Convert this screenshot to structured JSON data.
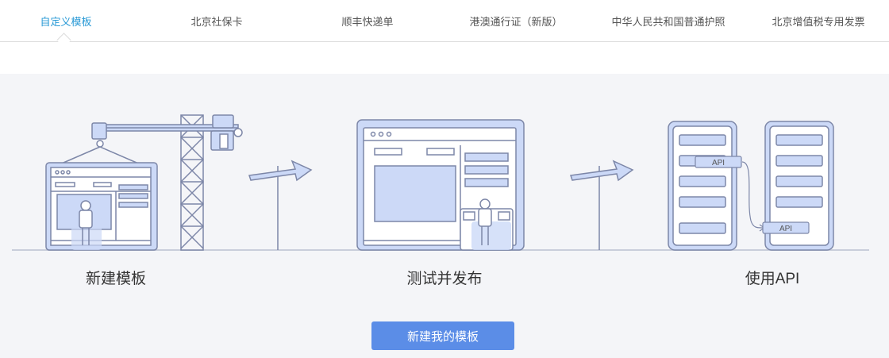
{
  "tabs": [
    {
      "label": "自定义模板",
      "active": true
    },
    {
      "label": "北京社保卡",
      "active": false
    },
    {
      "label": "顺丰快递单",
      "active": false
    },
    {
      "label": "港澳通行证（新版）",
      "active": false
    },
    {
      "label": "中华人民共和国普通护照",
      "active": false
    },
    {
      "label": "北京增值税专用发票",
      "active": false
    }
  ],
  "steps": [
    {
      "label": "新建模板"
    },
    {
      "label": "测试并发布"
    },
    {
      "label": "使用API"
    }
  ],
  "api_tags": [
    "API",
    "API"
  ],
  "cta": {
    "label": "新建我的模板"
  },
  "colors": {
    "accent": "#2a9ad6",
    "button": "#5b8de7",
    "panel_bg": "#f4f5f8",
    "illustration_fill": "#ccd9f7",
    "illustration_stroke": "#7d87a8"
  }
}
